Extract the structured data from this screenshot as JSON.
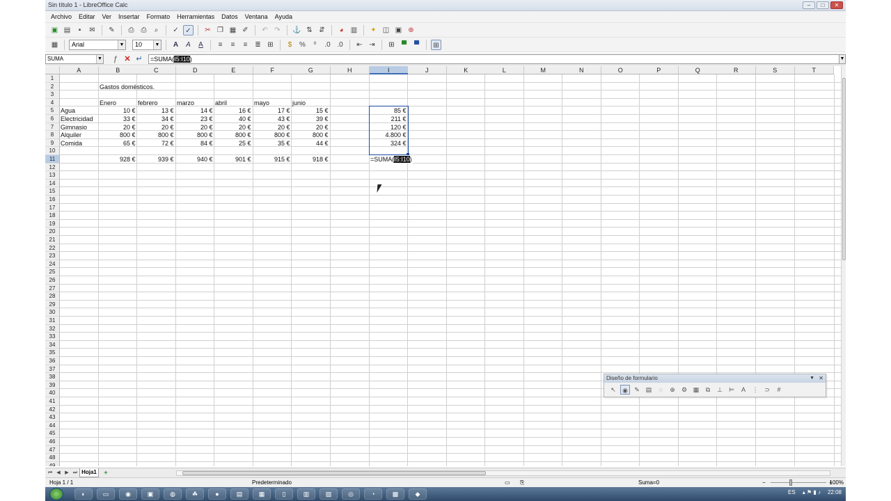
{
  "window": {
    "title": "Sin título 1 - LibreOffice Calc",
    "buttons": [
      "–",
      "□",
      "✕"
    ]
  },
  "menu": [
    "Archivo",
    "Editar",
    "Ver",
    "Insertar",
    "Formato",
    "Herramientas",
    "Datos",
    "Ventana",
    "Ayuda"
  ],
  "toolbar": {
    "font_name": "Arial",
    "font_size": "10"
  },
  "formula_bar": {
    "name_box": "SUMA",
    "formula_prefix": "=SUMA(",
    "formula_selected": "I5:I10",
    "formula_suffix": ")"
  },
  "sheet": {
    "columns": [
      "A",
      "B",
      "C",
      "D",
      "E",
      "F",
      "G",
      "H",
      "I",
      "J",
      "K",
      "L",
      "M",
      "N",
      "O",
      "P",
      "Q",
      "R",
      "S",
      "T"
    ],
    "active_column": "I",
    "active_row": 11,
    "row_count": 49,
    "title": "Gastos domésticos.",
    "months": [
      "Enero",
      "febrero",
      "marzo",
      "abril",
      "mayo",
      "junio"
    ],
    "rows": [
      {
        "label": "Agua",
        "values": [
          "10 €",
          "13 €",
          "14 €",
          "16 €",
          "17 €",
          "15 €"
        ],
        "total": "85 €"
      },
      {
        "label": "Electricidad",
        "values": [
          "33 €",
          "34 €",
          "23 €",
          "40 €",
          "43 €",
          "39 €"
        ],
        "total": "211 €"
      },
      {
        "label": "Gimnasio",
        "values": [
          "20 €",
          "20 €",
          "20 €",
          "20 €",
          "20 €",
          "20 €"
        ],
        "total": "120 €"
      },
      {
        "label": "Alquiler",
        "values": [
          "800 €",
          "800 €",
          "800 €",
          "800 €",
          "800 €",
          "800 €"
        ],
        "total": "4.800 €"
      },
      {
        "label": "Comida",
        "values": [
          "65 €",
          "72 €",
          "84 €",
          "25 €",
          "35 €",
          "44 €"
        ],
        "total": "324 €"
      }
    ],
    "totals": [
      "928 €",
      "939 €",
      "940 €",
      "901 €",
      "915 €",
      "918 €"
    ],
    "edit_cell": {
      "prefix": "=SUMA(",
      "selected": "I5:I10",
      "suffix": ")"
    }
  },
  "sheet_tabs": {
    "active": "Hoja1",
    "add": "+"
  },
  "status": {
    "sheet": "Hoja 1 / 1",
    "style": "Predeterminado",
    "sum": "Suma=0",
    "zoom": "100%"
  },
  "form_toolbar": {
    "title": "Diseño de formulario"
  },
  "taskbar": {
    "lang": "ES",
    "time": "22:08"
  }
}
